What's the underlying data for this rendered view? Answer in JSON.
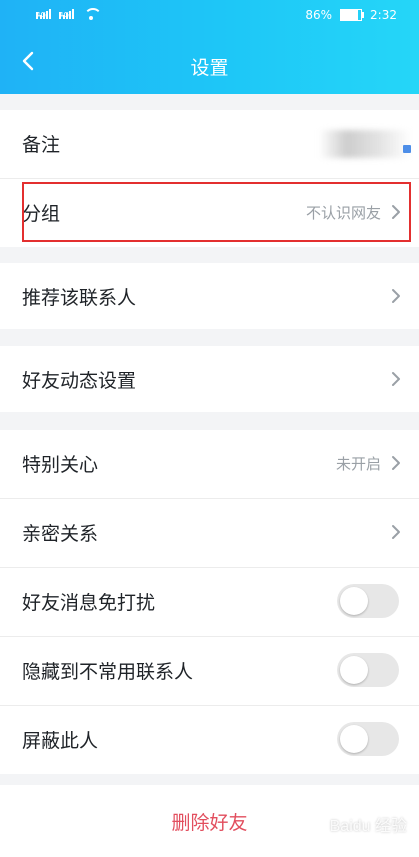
{
  "status_bar": {
    "signal_text_1": "4G",
    "signal_text_2": "4G",
    "battery_percent": "86%",
    "battery_fill": 0.86,
    "time": "2:32"
  },
  "header": {
    "title": "设置",
    "back_icon": "back-chevron-icon"
  },
  "settings": {
    "remark_label": "备注",
    "group_label": "分组",
    "group_value": "不认识网友",
    "recommend_label": "推荐该联系人",
    "friend_dynamic_label": "好友动态设置",
    "special_care_label": "特别关心",
    "special_care_value": "未开启",
    "intimate_label": "亲密关系",
    "mute_label": "好友消息免打扰",
    "mute_enabled": false,
    "hide_label": "隐藏到不常用联系人",
    "hide_enabled": false,
    "block_label": "屏蔽此人",
    "block_enabled": false
  },
  "footer": {
    "delete_label": "删除好友"
  },
  "watermark": "Baidu 经验",
  "colors": {
    "header_start": "#1fb2f6",
    "header_end": "#25d6f8",
    "delete_text": "#e24e5e",
    "highlight": "#e32f2f"
  }
}
